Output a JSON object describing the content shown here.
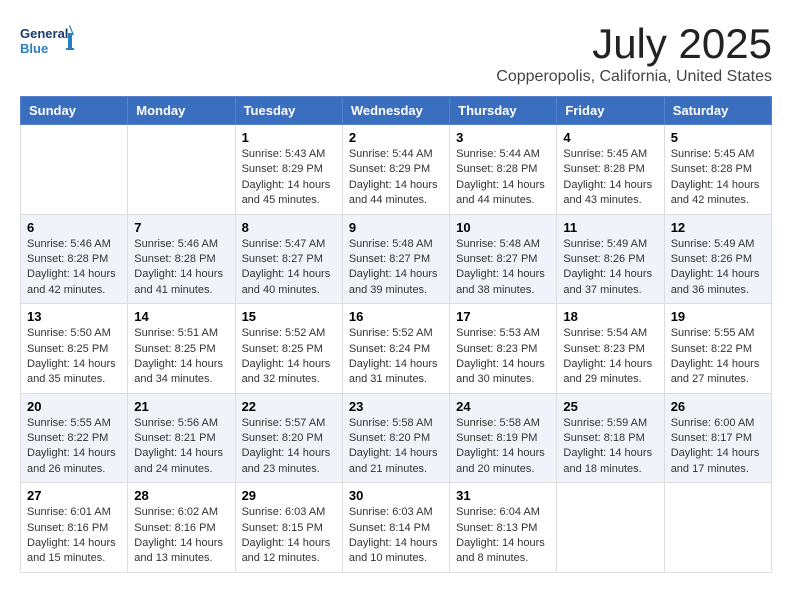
{
  "header": {
    "logo_general": "General",
    "logo_blue": "Blue",
    "month": "July 2025",
    "location": "Copperopolis, California, United States"
  },
  "weekdays": [
    "Sunday",
    "Monday",
    "Tuesday",
    "Wednesday",
    "Thursday",
    "Friday",
    "Saturday"
  ],
  "weeks": [
    [
      {
        "day": "",
        "info": ""
      },
      {
        "day": "",
        "info": ""
      },
      {
        "day": "1",
        "info": "Sunrise: 5:43 AM\nSunset: 8:29 PM\nDaylight: 14 hours and 45 minutes."
      },
      {
        "day": "2",
        "info": "Sunrise: 5:44 AM\nSunset: 8:29 PM\nDaylight: 14 hours and 44 minutes."
      },
      {
        "day": "3",
        "info": "Sunrise: 5:44 AM\nSunset: 8:28 PM\nDaylight: 14 hours and 44 minutes."
      },
      {
        "day": "4",
        "info": "Sunrise: 5:45 AM\nSunset: 8:28 PM\nDaylight: 14 hours and 43 minutes."
      },
      {
        "day": "5",
        "info": "Sunrise: 5:45 AM\nSunset: 8:28 PM\nDaylight: 14 hours and 42 minutes."
      }
    ],
    [
      {
        "day": "6",
        "info": "Sunrise: 5:46 AM\nSunset: 8:28 PM\nDaylight: 14 hours and 42 minutes."
      },
      {
        "day": "7",
        "info": "Sunrise: 5:46 AM\nSunset: 8:28 PM\nDaylight: 14 hours and 41 minutes."
      },
      {
        "day": "8",
        "info": "Sunrise: 5:47 AM\nSunset: 8:27 PM\nDaylight: 14 hours and 40 minutes."
      },
      {
        "day": "9",
        "info": "Sunrise: 5:48 AM\nSunset: 8:27 PM\nDaylight: 14 hours and 39 minutes."
      },
      {
        "day": "10",
        "info": "Sunrise: 5:48 AM\nSunset: 8:27 PM\nDaylight: 14 hours and 38 minutes."
      },
      {
        "day": "11",
        "info": "Sunrise: 5:49 AM\nSunset: 8:26 PM\nDaylight: 14 hours and 37 minutes."
      },
      {
        "day": "12",
        "info": "Sunrise: 5:49 AM\nSunset: 8:26 PM\nDaylight: 14 hours and 36 minutes."
      }
    ],
    [
      {
        "day": "13",
        "info": "Sunrise: 5:50 AM\nSunset: 8:25 PM\nDaylight: 14 hours and 35 minutes."
      },
      {
        "day": "14",
        "info": "Sunrise: 5:51 AM\nSunset: 8:25 PM\nDaylight: 14 hours and 34 minutes."
      },
      {
        "day": "15",
        "info": "Sunrise: 5:52 AM\nSunset: 8:25 PM\nDaylight: 14 hours and 32 minutes."
      },
      {
        "day": "16",
        "info": "Sunrise: 5:52 AM\nSunset: 8:24 PM\nDaylight: 14 hours and 31 minutes."
      },
      {
        "day": "17",
        "info": "Sunrise: 5:53 AM\nSunset: 8:23 PM\nDaylight: 14 hours and 30 minutes."
      },
      {
        "day": "18",
        "info": "Sunrise: 5:54 AM\nSunset: 8:23 PM\nDaylight: 14 hours and 29 minutes."
      },
      {
        "day": "19",
        "info": "Sunrise: 5:55 AM\nSunset: 8:22 PM\nDaylight: 14 hours and 27 minutes."
      }
    ],
    [
      {
        "day": "20",
        "info": "Sunrise: 5:55 AM\nSunset: 8:22 PM\nDaylight: 14 hours and 26 minutes."
      },
      {
        "day": "21",
        "info": "Sunrise: 5:56 AM\nSunset: 8:21 PM\nDaylight: 14 hours and 24 minutes."
      },
      {
        "day": "22",
        "info": "Sunrise: 5:57 AM\nSunset: 8:20 PM\nDaylight: 14 hours and 23 minutes."
      },
      {
        "day": "23",
        "info": "Sunrise: 5:58 AM\nSunset: 8:20 PM\nDaylight: 14 hours and 21 minutes."
      },
      {
        "day": "24",
        "info": "Sunrise: 5:58 AM\nSunset: 8:19 PM\nDaylight: 14 hours and 20 minutes."
      },
      {
        "day": "25",
        "info": "Sunrise: 5:59 AM\nSunset: 8:18 PM\nDaylight: 14 hours and 18 minutes."
      },
      {
        "day": "26",
        "info": "Sunrise: 6:00 AM\nSunset: 8:17 PM\nDaylight: 14 hours and 17 minutes."
      }
    ],
    [
      {
        "day": "27",
        "info": "Sunrise: 6:01 AM\nSunset: 8:16 PM\nDaylight: 14 hours and 15 minutes."
      },
      {
        "day": "28",
        "info": "Sunrise: 6:02 AM\nSunset: 8:16 PM\nDaylight: 14 hours and 13 minutes."
      },
      {
        "day": "29",
        "info": "Sunrise: 6:03 AM\nSunset: 8:15 PM\nDaylight: 14 hours and 12 minutes."
      },
      {
        "day": "30",
        "info": "Sunrise: 6:03 AM\nSunset: 8:14 PM\nDaylight: 14 hours and 10 minutes."
      },
      {
        "day": "31",
        "info": "Sunrise: 6:04 AM\nSunset: 8:13 PM\nDaylight: 14 hours and 8 minutes."
      },
      {
        "day": "",
        "info": ""
      },
      {
        "day": "",
        "info": ""
      }
    ]
  ]
}
